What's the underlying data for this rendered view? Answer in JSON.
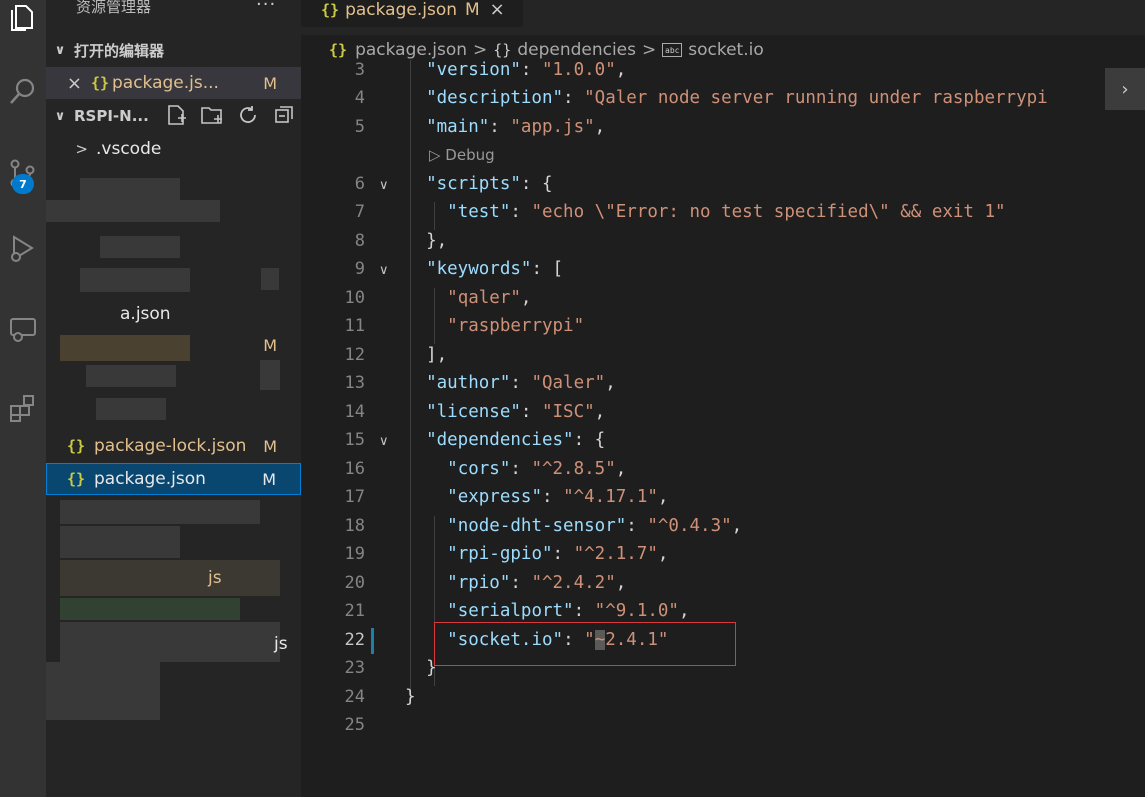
{
  "explorer": {
    "title": "资源管理器",
    "more": "···",
    "open_editors_label": "打开的编辑器",
    "open_editor": {
      "close": "×",
      "name": "package.js...",
      "status": "M"
    },
    "project_label": "RSPI-N...",
    "tree": [
      {
        "name": ".vscode",
        "status": ""
      },
      {
        "name": "a.json",
        "status": ""
      },
      {
        "name": "package-lock.json",
        "status": "M"
      },
      {
        "name": "package.json",
        "status": "M"
      },
      {
        "name": "js",
        "status": ""
      },
      {
        "name": "js",
        "status": ""
      },
      {
        "name": "M",
        "status": ""
      },
      {
        "name": "M",
        "status": ""
      }
    ]
  },
  "activity": {
    "scm_badge": "7"
  },
  "tab": {
    "icon": "{}",
    "name": "package.json",
    "status": "M",
    "close": "×"
  },
  "breadcrumb": {
    "file": "package.json",
    "dep": "dependencies",
    "leaf": "socket.io",
    "obj_icon": "{}",
    "file_icon": "{}",
    "str_icon": "abc"
  },
  "codelens": "▷ Debug",
  "scroll_chevron": "›",
  "code": {
    "gutter": [
      "3",
      "4",
      "5",
      "6",
      "7",
      "8",
      "9",
      "10",
      "11",
      "12",
      "13",
      "14",
      "15",
      "16",
      "17",
      "18",
      "19",
      "20",
      "21",
      "22",
      "23",
      "24",
      "25"
    ],
    "l3": {
      "k": "\"version\"",
      "s": "\"1.0.0\""
    },
    "l4": {
      "k": "\"description\"",
      "s": "\"Qaler node server running under raspberrypi"
    },
    "l5": {
      "k": "\"main\"",
      "s": "\"app.js\""
    },
    "l6": {
      "k": "\"scripts\"",
      "p": ": {"
    },
    "l7": {
      "k": "\"test\"",
      "s": "\"echo \\\"Error: no test specified\\\" && exit 1\""
    },
    "l8": {
      "p": "},"
    },
    "l9": {
      "k": "\"keywords\"",
      "p": ": ["
    },
    "l10": {
      "s": "\"qaler\""
    },
    "l11": {
      "s": "\"raspberrypi\""
    },
    "l12": {
      "p": "],"
    },
    "l13": {
      "k": "\"author\"",
      "s": "\"Qaler\""
    },
    "l14": {
      "k": "\"license\"",
      "s": "\"ISC\""
    },
    "l15": {
      "k": "\"dependencies\"",
      "p": ": {"
    },
    "l16": {
      "k": "\"cors\"",
      "s": "\"^2.8.5\""
    },
    "l17": {
      "k": "\"express\"",
      "s": "\"^4.17.1\""
    },
    "l18": {
      "k": "\"node-dht-sensor\"",
      "s": "\"^0.4.3\""
    },
    "l19": {
      "k": "\"rpi-gpio\"",
      "s": "\"^2.1.7\""
    },
    "l20": {
      "k": "\"rpio\"",
      "s": "\"^2.4.2\""
    },
    "l21": {
      "k": "\"serialport\"",
      "s": "\"^9.1.0\""
    },
    "l22": {
      "k": "\"socket.io\"",
      "s1": "\"",
      "cur": "~",
      "s2": "2.4.1\""
    },
    "l23": {
      "p": "}"
    },
    "l24": {
      "p": "}"
    },
    "colon": ": ",
    "comma": ","
  }
}
